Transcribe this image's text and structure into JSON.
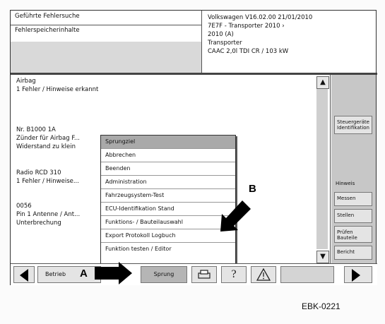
{
  "header": {
    "left_row1": "Geführte Fehlersuche",
    "left_row2": "Fehlerspeicherinhalte",
    "right_lines": [
      "Volkswagen       V16.02.00 21/01/2010",
      "7E7F - Transporter 2010 ›",
      "2010 (A)",
      "Transporter",
      "CAAC 2,0l TDI CR / 103 kW"
    ]
  },
  "main_lines": [
    "Airbag",
    "1 Fehler / Hinweise erkannt",
    "",
    "",
    "Nr.      B1000 1A",
    "Zünder für Airbag F...",
    "Widerstand zu klein",
    "",
    "Radio RCD 310",
    "1 Fehler / Hinweise...",
    "",
    "0056",
    "Pin 1 Antenne / Ant...",
    "Unterbrechung"
  ],
  "menu_items": [
    "Sprungziel",
    "Abbrechen",
    "Beenden",
    "Administration",
    "Fahrzeugsystem-Test",
    "ECU-Identifikation Stand",
    "Funktions- / Bauteilauswahl",
    "Export Protokoll Logbuch",
    "Funktion testen / Editor"
  ],
  "menu_selected_index": 0,
  "side_buttons": [
    "Steuergeräte Identifikation",
    "Messen",
    "Stellen",
    "Prüfen Bauteile",
    "Bericht"
  ],
  "side_note": "Hinweis",
  "toolbar": {
    "back_label": "Betrieb",
    "jump_label": "Sprung",
    "print_icon": "print-icon",
    "help_icon": "help-icon",
    "warning_icon": "warning-icon"
  },
  "callouts": {
    "a": "A",
    "b": "B"
  },
  "code": "EBK-0221",
  "colors": {
    "selection": "#a9a9a9",
    "panel": "#c7c7c7",
    "header_gray": "#d9d9d9"
  }
}
